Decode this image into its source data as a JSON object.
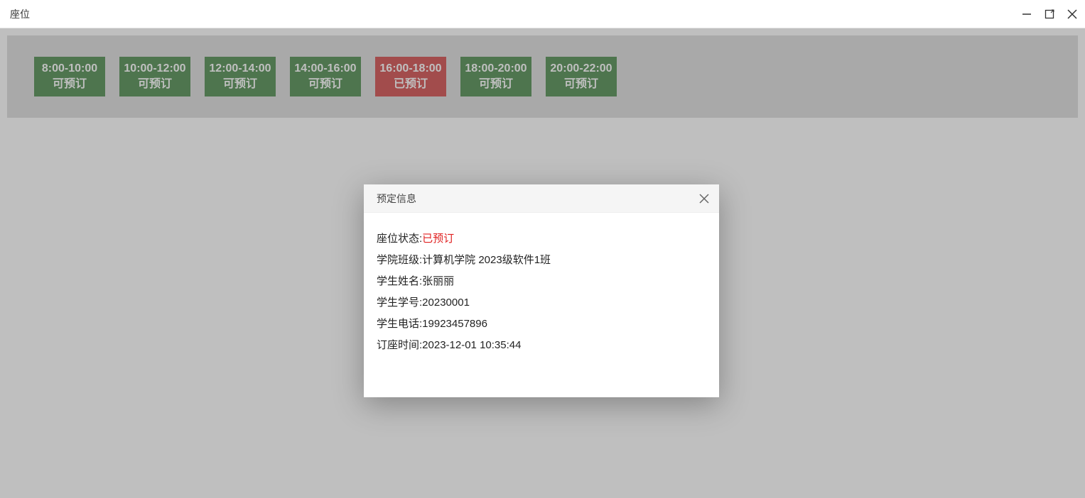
{
  "window": {
    "title": "座位"
  },
  "slots": [
    {
      "time": "8:00-10:00",
      "status": "可预订",
      "state": "available"
    },
    {
      "time": "10:00-12:00",
      "status": "可预订",
      "state": "available"
    },
    {
      "time": "12:00-14:00",
      "status": "可预订",
      "state": "available"
    },
    {
      "time": "14:00-16:00",
      "status": "可预订",
      "state": "available"
    },
    {
      "time": "16:00-18:00",
      "status": "已预订",
      "state": "reserved"
    },
    {
      "time": "18:00-20:00",
      "status": "可预订",
      "state": "available"
    },
    {
      "time": "20:00-22:00",
      "status": "可预订",
      "state": "available"
    }
  ],
  "dialog": {
    "title": "预定信息",
    "rows": {
      "status_label": "座位状态:",
      "status_value": "已预订",
      "class_label": "学院班级:",
      "class_value": "计算机学院 2023级软件1班",
      "name_label": "学生姓名:",
      "name_value": "张丽丽",
      "id_label": "学生学号:",
      "id_value": "20230001",
      "phone_label": "学生电话:",
      "phone_value": "19923457896",
      "time_label": "订座时间:",
      "time_value": "2023-12-01 10:35:44"
    }
  }
}
